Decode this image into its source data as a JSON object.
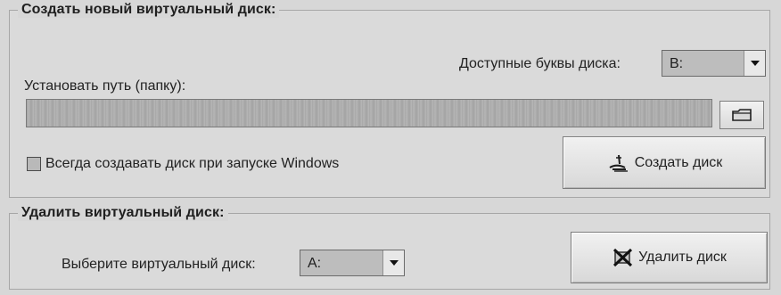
{
  "create_section": {
    "title": "Создать новый виртуальный диск:",
    "drive_letters_label": "Доступные буквы диска:",
    "drive_letter_value": "B:",
    "path_label": "Установать путь (папку):",
    "path_value": "",
    "startup_checkbox_label": "Всегда создавать диск при запуске Windows",
    "startup_checkbox_checked": false,
    "create_button_label": "Создать диск"
  },
  "delete_section": {
    "title": "Удалить виртуальный диск:",
    "select_drive_label": "Выберите виртуальный диск:",
    "select_drive_value": "A:",
    "delete_button_label": "Удалить диск"
  },
  "icons": {
    "dropdown": "chevron-down-icon",
    "browse": "folder-icon",
    "create": "create-disk-icon",
    "delete": "delete-disk-icon"
  }
}
